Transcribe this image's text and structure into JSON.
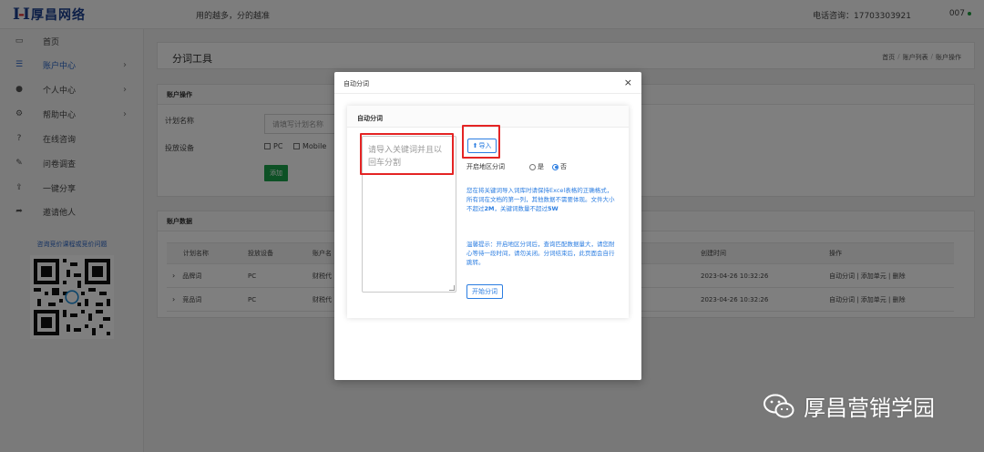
{
  "header": {
    "logo_text": "厚昌网络",
    "slogan": "用的越多，分的越准",
    "phone_label": "电话咨询：17703303921",
    "user_name": "007"
  },
  "sidebar": {
    "items": [
      {
        "label": "首页",
        "icon": "laptop-icon",
        "has_chevron": false,
        "active": false
      },
      {
        "label": "账户中心",
        "icon": "list-icon",
        "has_chevron": true,
        "active": true
      },
      {
        "label": "个人中心",
        "icon": "users-icon",
        "has_chevron": true,
        "active": false
      },
      {
        "label": "帮助中心",
        "icon": "gears-icon",
        "has_chevron": true,
        "active": false
      },
      {
        "label": "在线咨询",
        "icon": "question-icon",
        "has_chevron": false,
        "active": false
      },
      {
        "label": "问卷调查",
        "icon": "edit-icon",
        "has_chevron": false,
        "active": false
      },
      {
        "label": "一键分享",
        "icon": "share-icon",
        "has_chevron": false,
        "active": false
      },
      {
        "label": "邀请他人",
        "icon": "forward-icon",
        "has_chevron": false,
        "active": false
      }
    ],
    "qr_caption": "咨询竞价课程或竞价问题"
  },
  "page": {
    "title": "分词工具",
    "breadcrumb": [
      "首页",
      "账户列表",
      "账户操作"
    ]
  },
  "account_ops": {
    "title": "账户操作",
    "plan_label": "计划名称",
    "plan_placeholder": "请填写计划名称",
    "device_label": "投放设备",
    "device_pc": "PC",
    "device_mobile": "Mobile",
    "add_button": "添加"
  },
  "account_data": {
    "title": "账户数据",
    "columns": [
      "计划名称",
      "投放设备",
      "账户名",
      "创建时间",
      "操作"
    ],
    "rows": [
      {
        "name": "品牌词",
        "device": "PC",
        "account": "财税代",
        "created": "2023-04-26 10:32:26",
        "actions": "自动分词 | 添加单元 | 删除"
      },
      {
        "name": "竞品词",
        "device": "PC",
        "account": "财税代",
        "created": "2023-04-26 10:32:26",
        "actions": "自动分词 | 添加单元 | 删除"
      }
    ]
  },
  "modal": {
    "title": "自动分词",
    "close_glyph": "×",
    "section_title": "自动分词",
    "textarea_placeholder": "请导入关键词并且以回车分割",
    "import_button": "导入",
    "region_label": "开启地区分词",
    "region_yes": "是",
    "region_no": "否",
    "region_selected": "否",
    "note1_a": "您在将关键词导入词库时请保持Excel表格的正确格式，所有词在文档的第一列，其他数据不需要体现。文件大小不超过",
    "note1_b": "2M",
    "note1_c": "，关键词数量不超过",
    "note1_d": "5W",
    "note2": "温馨提示：开启地区分词后，查询匹配数据量大，请您耐心等待一段时间，请勿关闭。分词结束后，此页面会自行跳转。",
    "start_button": "开始分词"
  },
  "watermark": {
    "text": "厚昌营销学园"
  },
  "colors": {
    "accent_blue": "#2b7de1",
    "highlight_red": "#e42424",
    "add_green": "#1aa34a",
    "brand_navy": "#1b3f8f"
  }
}
